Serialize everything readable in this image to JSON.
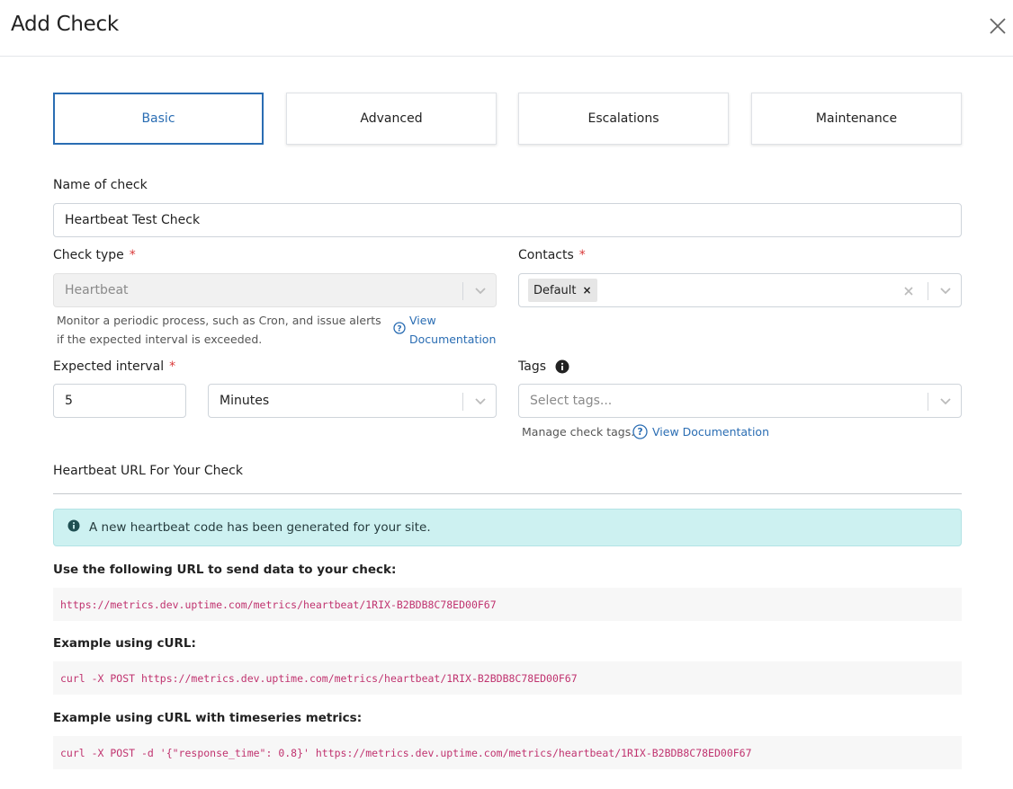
{
  "modal": {
    "title": "Add Check",
    "close_icon": "close-icon"
  },
  "tabs": [
    {
      "label": "Basic",
      "active": true
    },
    {
      "label": "Advanced",
      "active": false
    },
    {
      "label": "Escalations",
      "active": false
    },
    {
      "label": "Maintenance",
      "active": false
    }
  ],
  "form": {
    "name": {
      "label": "Name of check",
      "value": "Heartbeat Test Check"
    },
    "check_type": {
      "label": "Check type",
      "required": "*",
      "value": "Heartbeat",
      "help": "Monitor a periodic process, such as Cron, and issue alerts if the expected interval is exceeded.",
      "doc_link_line1": "View",
      "doc_link_line2": "Documentation"
    },
    "contacts": {
      "label": "Contacts",
      "required": "*",
      "chip": "Default",
      "chip_remove": "×"
    },
    "interval": {
      "label": "Expected interval",
      "required": "*",
      "value": "5",
      "unit": "Minutes"
    },
    "tags": {
      "label": "Tags",
      "placeholder": "Select tags...",
      "help": "Manage check tags.",
      "doc_link": "View Documentation"
    }
  },
  "heartbeat": {
    "section_title": "Heartbeat URL For Your Check",
    "alert": "A new heartbeat code has been generated for your site.",
    "url_label": "Use the following URL to send data to your check:",
    "url": "https://metrics.dev.uptime.com/metrics/heartbeat/1RIX-B2BDB8C78ED00F67",
    "curl_label": "Example using cURL:",
    "curl": "curl -X POST https://metrics.dev.uptime.com/metrics/heartbeat/1RIX-B2BDB8C78ED00F67",
    "curl_ts_label": "Example using cURL with timeseries metrics:",
    "curl_ts": "curl -X POST -d '{\"response_time\": 0.8}' https://metrics.dev.uptime.com/metrics/heartbeat/1RIX-B2BDB8C78ED00F67"
  },
  "colors": {
    "accent": "#2a6db3",
    "required": "#d93838",
    "alert_bg": "#cdf1f1",
    "code_text": "#c0336f"
  }
}
